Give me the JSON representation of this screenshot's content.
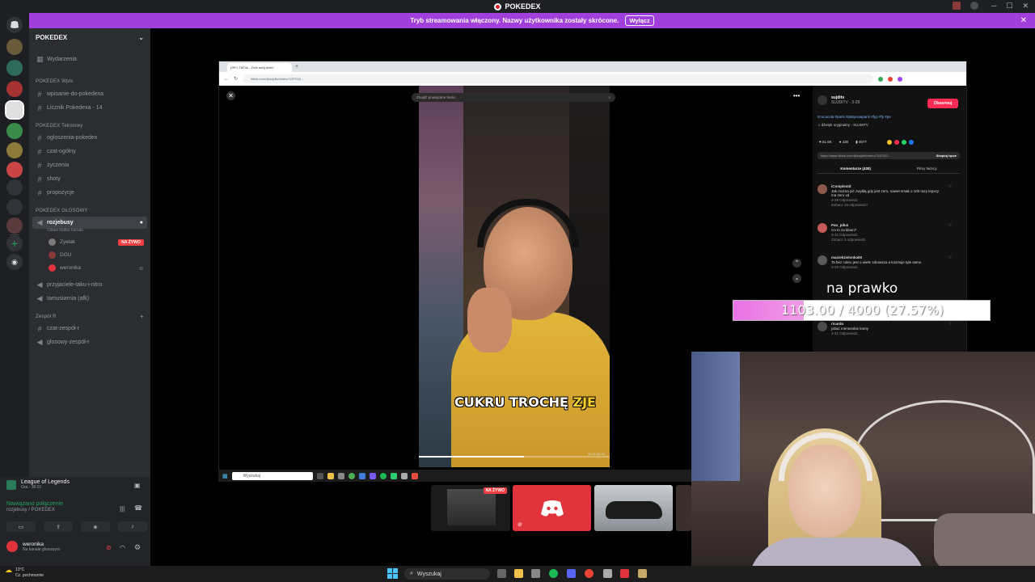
{
  "window": {
    "title": "POKEDEX",
    "controls": [
      "─",
      "☐",
      "✕"
    ]
  },
  "banner": {
    "text": "Tryb streamowania włączony. Nazwy użytkownika zostały skrócone.",
    "button": "Wyłącz",
    "color": "#a13fdc"
  },
  "server": {
    "name": "POKEDEX",
    "events": "Wydarzenia",
    "categories": [
      {
        "name": "POKEDEX Wpis"
      },
      {
        "name": "POKEDEX Tekstowy"
      },
      {
        "name": "POKEDEX GŁOSOWY"
      },
      {
        "name": "Zespół R"
      }
    ],
    "channels": {
      "wpis": [
        "wpisanie-do-pokedexa",
        "Licznik Pokedexa - 14"
      ],
      "tekstowy": [
        "ogloszenia-pokedex",
        "czat-ogólny",
        "życzenia",
        "shoty",
        "propozycje"
      ],
      "voice_active": "rozjebusy",
      "voice_status": "Ustaw status kanału",
      "voice_users": [
        "Zyelak",
        "DGU",
        "weronika"
      ],
      "live_badge": "NA ŻYWO",
      "voice_other": [
        "przyjaciele-taku-i-nitro",
        "Iamusiarnia (afk)"
      ],
      "zespol": [
        "czat-zespół-r",
        "glosowy-zespół-r"
      ]
    }
  },
  "voice_panel": {
    "activity": "League of Legends",
    "activity_sub": "Gra - 36:01",
    "connection": "Nawiązano połączenie",
    "channel": "rozjebusy / POKEDEX",
    "user": "weronika",
    "user_status": "Na kanale głosowym"
  },
  "browser": {
    "tab_title": "(99+) TikTok - Zrób swój dzień",
    "url": "tiktok.com/@sujditv/video/7437016...",
    "search_placeholder": "Znajdź powiązane treści"
  },
  "tiktok": {
    "username": "sujditv",
    "handle": "SUJDITV · 3-29",
    "follow": "Obserwuj",
    "tags": "#cocacola #paris #platynowparis #fyp #fy #pe",
    "sound": "♫ dźwięk oryginalny - SUJDITV",
    "stats": [
      "51.6K",
      "430",
      "4677"
    ],
    "link": "https://www.tiktok.com/@sujditv/video/7437022...",
    "copy_link": "Skopiuj łącze",
    "tabs": [
      "Komentarze (430)",
      "Filmy twórcy"
    ],
    "caption_main": "CUKRU TROCHĘ ",
    "caption_highlight": "ZJE",
    "video_time": "00:11/00:15",
    "comments": [
      {
        "user": "iComplextd",
        "text": "Jak można pić zwykłą gdy jest zero, nawet smak o 100 razy lepszy ma zero xd",
        "meta": "3-29 Odpowiedz",
        "more": "Zobacz 18 odpowiedzi"
      },
      {
        "user": "Pan_piłus",
        "text": "Co to za klaun?",
        "meta": "3-31 Odpowiedz",
        "more": "Zobacz 3 odpowiedzi"
      },
      {
        "user": "maciekzielonka00",
        "text": "Ta bez cukru jest o wiele zdrowsza a kosztuje tyle samo",
        "meta": "3-29 Odpowiedz",
        "more": ""
      },
      {
        "user": "ricardo",
        "text": "jobać mentorskie komy",
        "meta": "3-31 Odpowiedz",
        "more": ""
      }
    ]
  },
  "goal": {
    "title": "na prawko",
    "text": "1103.00 / 4000 (27.57%)",
    "progress": 0.2757
  },
  "inner_taskbar": {
    "search": "Wyszukaj"
  },
  "stream_thumb": {
    "live": "NA ŻYWO"
  },
  "taskbar": {
    "weather_temp": "13°C",
    "weather_desc": "Cz. pochmurnie",
    "search": "Wyszukaj"
  }
}
